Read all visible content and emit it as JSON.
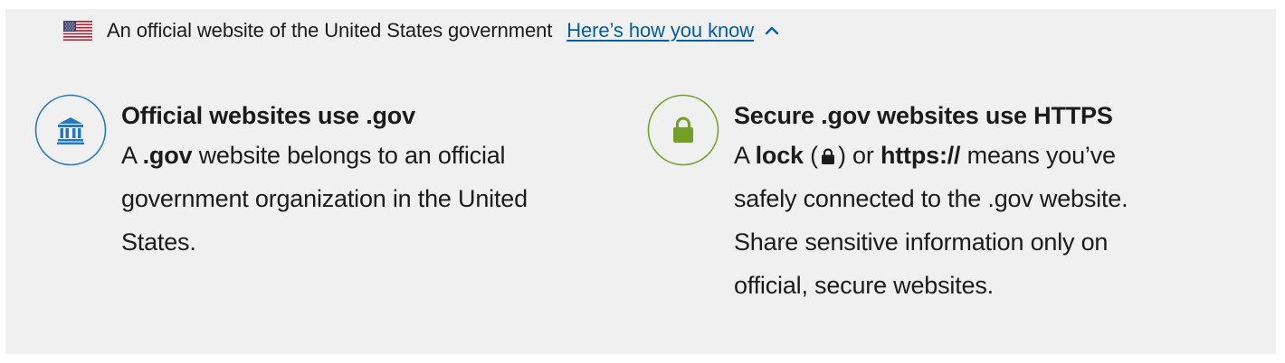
{
  "banner": {
    "flag_icon": "us-flag-icon",
    "official_text": "An official website of the United States government",
    "how_you_know_link": "Here’s how you know",
    "toggle_icon": "chevron-up-icon"
  },
  "guidance": [
    {
      "icon": "government-building-icon",
      "icon_color": "#2378c3",
      "title": "Official websites use .gov",
      "body_lines": [
        {
          "prefix": "A ",
          "bold": ".gov",
          "suffix": " website belongs to an official"
        },
        "government organization in the United",
        "States."
      ]
    },
    {
      "icon": "lock-icon",
      "icon_color": "#719f2a",
      "title": "Secure .gov websites use HTTPS",
      "body_lines": [
        {
          "a": "A ",
          "lock": "lock",
          "paren_open": " (",
          "paren_close": ") or ",
          "https": "https://",
          "suffix": " means you’ve"
        },
        "safely connected to the .gov website.",
        "Share sensitive information only on",
        "official, secure websites."
      ]
    }
  ],
  "colors": {
    "background": "#f0f0f0",
    "link": "#005ea2",
    "text": "#1b1b1b"
  }
}
